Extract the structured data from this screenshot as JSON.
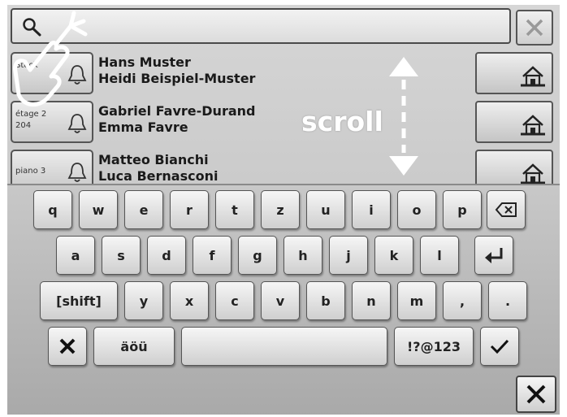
{
  "contacts": [
    {
      "location": "Stock",
      "names": [
        "Hans Muster",
        "Heidi Beispiel-Muster"
      ]
    },
    {
      "location": "étage 2\n204",
      "names": [
        "Gabriel Favre-Durand",
        "Emma Favre"
      ]
    },
    {
      "location": "piano 3",
      "names": [
        "Matteo Bianchi",
        "Luca Bernasconi"
      ]
    }
  ],
  "gesture": {
    "label": "scroll"
  },
  "keyboard": {
    "row1": [
      "q",
      "w",
      "e",
      "r",
      "t",
      "z",
      "u",
      "i",
      "o",
      "p"
    ],
    "row2": [
      "a",
      "s",
      "d",
      "f",
      "g",
      "h",
      "j",
      "k",
      "l"
    ],
    "row3_shift": "[shift]",
    "row3": [
      "y",
      "x",
      "c",
      "v",
      "b",
      "n",
      "m",
      ",",
      "."
    ],
    "umlaut_key": "äöü",
    "symbols_key": "!?@123"
  },
  "icons": [
    "search-icon",
    "clear-icon",
    "hand-touch-icon",
    "bell-icon",
    "home-icon",
    "scroll-arrow-icon",
    "backspace-icon",
    "enter-icon",
    "cancel-icon",
    "confirm-icon",
    "close-icon"
  ]
}
